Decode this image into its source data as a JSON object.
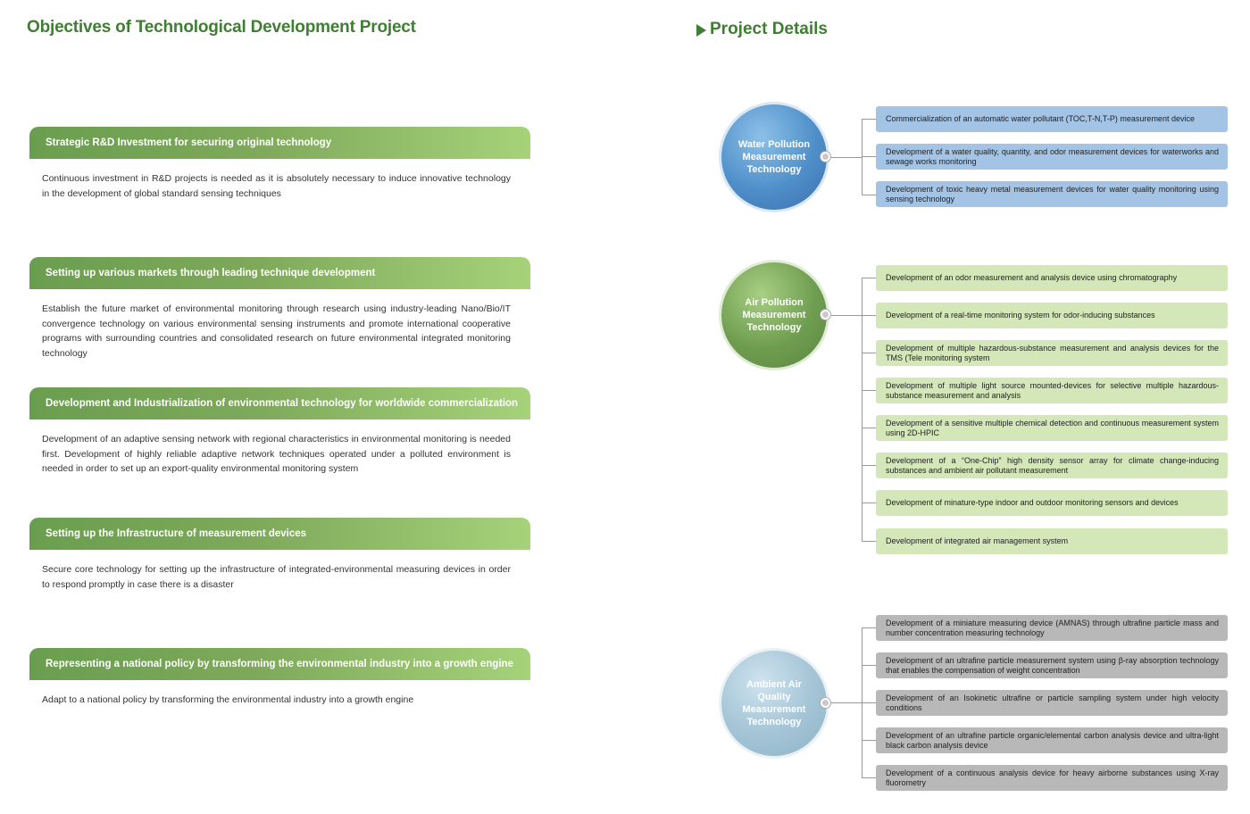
{
  "left": {
    "title": "Objectives of Technological Development Project",
    "objectives": [
      {
        "heading": "Strategic R&D Investment for securing original technology",
        "body": "Continuous investment in R&D projects is needed as it is absolutely necessary to induce innovative technology in the development of global standard sensing techniques"
      },
      {
        "heading": "Setting up various markets through leading technique development",
        "body": "Establish the future market of environmental monitoring through research using industry-leading Nano/Bio/IT convergence technology on various environmental sensing instruments and promote international cooperative programs with surrounding countries and consolidated research on future environmental integrated monitoring technology"
      },
      {
        "heading": "Development and Industrialization of environmental technology for worldwide commercialization",
        "body": "Development of an adaptive sensing network with regional characteristics in environmental monitoring is needed first. Development of highly reliable adaptive network techniques operated under a polluted environment is needed in order to set up an export-quality environmental monitoring system"
      },
      {
        "heading": "Setting up the Infrastructure of measurement devices",
        "body": "Secure core technology for setting up the infrastructure of integrated-environmental measuring devices in order to respond promptly in case there is a disaster"
      },
      {
        "heading": "Representing a national policy by transforming the environmental industry into a growth engine",
        "body": "Adapt to a national policy by transforming the environmental industry into a growth engine"
      }
    ]
  },
  "right": {
    "title": "Project Details",
    "groups": [
      {
        "name": "Water Pollution Measurement Technology",
        "items": [
          "Commercialization of an automatic water pollutant (TOC,T-N,T-P) measurement device",
          "Development of a water quality, quantity, and odor measurement devices for waterworks and sewage works monitoring",
          "Development of toxic heavy metal measurement devices for water quality monitoring using sensing technology"
        ]
      },
      {
        "name": "Air Pollution Measurement Technology",
        "items": [
          "Development of an odor measurement and analysis device using chromatography",
          "Development of a real-time monitoring system for odor-inducing substances",
          "Development of multiple hazardous-substance measurement and analysis devices for the TMS (Tele monitoring system",
          "Development of multiple light source mounted-devices for selective multiple hazardous-substance measurement and analysis",
          "Development of a sensitive multiple chemical detection and continuous measurement system using 2D-HPIC",
          "Development of a “One-Chip” high density sensor array for climate change-inducing substances and ambient air pollutant measurement",
          "Development of minature-type indoor and outdoor monitoring sensors and devices",
          "Development of integrated air management system"
        ]
      },
      {
        "name": "Ambient Air Quality Measurement Technology",
        "items": [
          "Development of a miniature measuring device (AMNAS) through ultrafine particle mass and number concentration measuring technology",
          "Development of an ultrafine particle measurement system using β-ray absorption technology that enables the compensation of weight concentration",
          "Development of an Isokinetic ultrafine or particle sampling system under high velocity conditions",
          "Development of an ultrafine particle organic/elemental carbon analysis device and ultra-light black carbon analysis device",
          "Development of a continuous analysis device for heavy airborne substances using X-ray fluorometry"
        ]
      }
    ]
  },
  "colors": {
    "title_green": "#3f7e33",
    "header_gradient_start": "#6a9e4f",
    "header_gradient_end": "#a6d27a",
    "water_blue": "#a4c4e6",
    "air_green": "#d3e7b9",
    "ambient_gray": "#b8b8b8"
  }
}
